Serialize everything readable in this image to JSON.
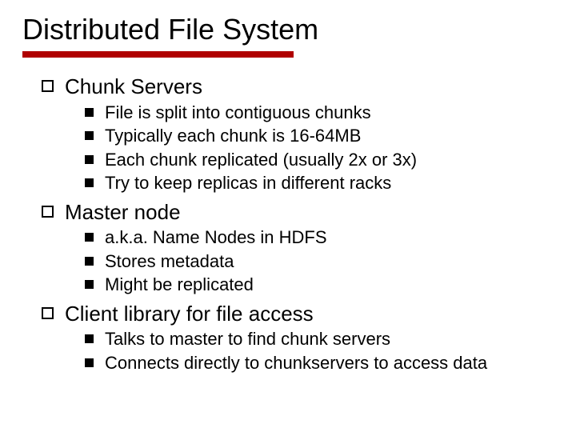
{
  "title": "Distributed File System",
  "sections": [
    {
      "heading": "Chunk Servers",
      "items": [
        "File is split into contiguous chunks",
        "Typically each chunk is 16-64MB",
        "Each chunk replicated (usually 2x or 3x)",
        "Try to keep replicas in different racks"
      ]
    },
    {
      "heading": "Master node",
      "items": [
        "a.k.a. Name Nodes in HDFS",
        "Stores metadata",
        "Might be replicated"
      ]
    },
    {
      "heading": "Client library for file access",
      "items": [
        "Talks to master to find chunk servers",
        "Connects directly to chunkservers to access data"
      ]
    }
  ]
}
